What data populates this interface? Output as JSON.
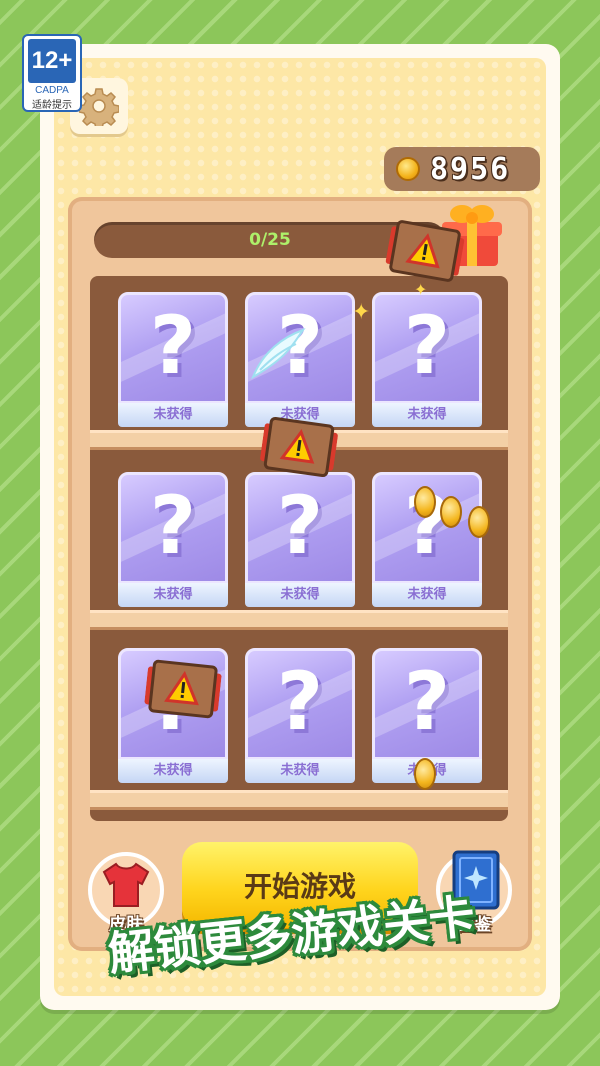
{
  "rating": {
    "age": "12+",
    "org": "CADPA",
    "tip": "适龄提示"
  },
  "coins": {
    "amount": "8956"
  },
  "progress": {
    "text": "0/25"
  },
  "slots": [
    {
      "label": "未获得"
    },
    {
      "label": "未获得"
    },
    {
      "label": "未获得"
    },
    {
      "label": "未获得"
    },
    {
      "label": "未获得"
    },
    {
      "label": "未获得"
    },
    {
      "label": "未获得"
    },
    {
      "label": "未获得"
    },
    {
      "label": "未获得"
    }
  ],
  "buttons": {
    "start": "开始游戏",
    "skin": "皮肤",
    "collection": "图鉴"
  },
  "banner": {
    "text": "解锁更多游戏关卡"
  },
  "colors": {
    "accent": "#ffd51e",
    "background": "#8cc65a",
    "slot": "#b0a0f2"
  },
  "icons": {
    "settings": "gear-icon",
    "coin": "coin-icon",
    "gift": "gift-icon",
    "skin": "shirt-icon",
    "collection": "book-icon"
  }
}
